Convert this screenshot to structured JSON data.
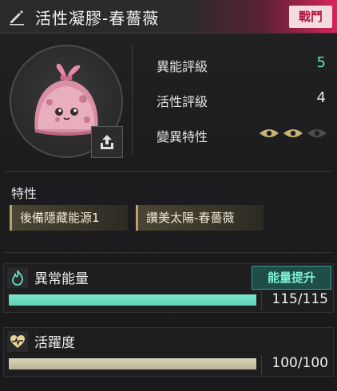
{
  "header": {
    "title": "活性凝膠-春薔薇",
    "tag": "戰鬥",
    "tag_color": "#b0163e",
    "accent_color": "#d8245a"
  },
  "portrait": {
    "subject": "pink-slime-creature",
    "share_icon": "share-upload-icon"
  },
  "stats": [
    {
      "label": "異能評級",
      "value": "5",
      "color": "#5fe3c7"
    },
    {
      "label": "活性評級",
      "value": "4"
    },
    {
      "label": "變異特性",
      "eyes_active": 2,
      "eyes_total": 3
    }
  ],
  "traits": {
    "title": "特性",
    "items": [
      "後備隱藏能源1",
      "讚美太陽-春薔薇"
    ]
  },
  "resources": {
    "anomaly_energy": {
      "label": "異常能量",
      "icon": "flame-icon",
      "value_text": "115/115",
      "fraction": 1.0,
      "button_label": "能量提升",
      "color": "#6fdcc4"
    },
    "activity": {
      "label": "活躍度",
      "icon": "heartbeat-icon",
      "value_text": "100/100",
      "fraction": 1.0,
      "color": "#c8c4a2"
    }
  }
}
